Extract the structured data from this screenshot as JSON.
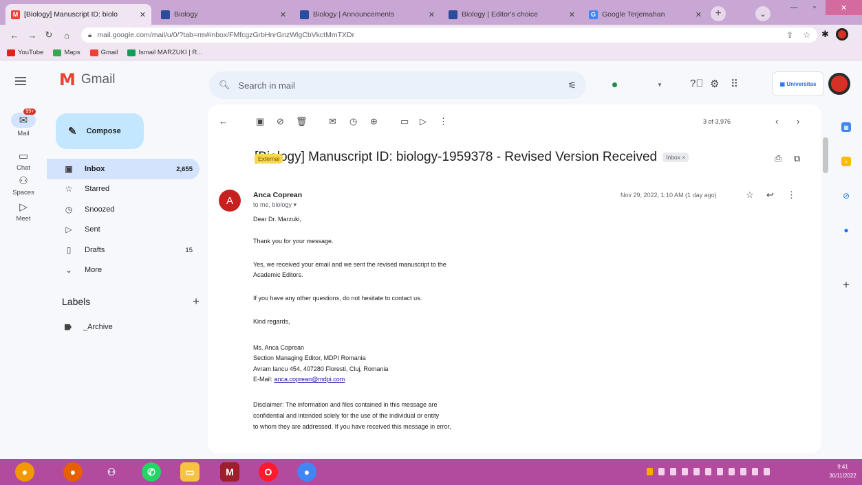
{
  "browser": {
    "tabs": [
      {
        "title": "[Biology] Manuscript ID: biolo",
        "active": true
      },
      {
        "title": "Biology",
        "active": false
      },
      {
        "title": "Biology | Announcements",
        "active": false
      },
      {
        "title": "Biology | Editor's choice",
        "active": false
      },
      {
        "title": "Google Terjemahan",
        "active": false
      }
    ],
    "url": "mail.google.com/mail/u/0/?tab=rm#inbox/FMfcgzGrbHnrGnzWlgCbVkctMmTXDr",
    "bookmarks": [
      "YouTube",
      "Maps",
      "Gmail",
      "Ismail MARZUKI | R..."
    ]
  },
  "gmail": {
    "app_name": "Gmail",
    "search_placeholder": "Search in mail",
    "compose_label": "Compose",
    "rail": [
      {
        "label": "Mail",
        "badge": "99+"
      },
      {
        "label": "Chat"
      },
      {
        "label": "Spaces"
      },
      {
        "label": "Meet"
      }
    ],
    "nav": [
      {
        "label": "Inbox",
        "count": "2,655"
      },
      {
        "label": "Starred",
        "count": ""
      },
      {
        "label": "Snoozed",
        "count": ""
      },
      {
        "label": "Sent",
        "count": ""
      },
      {
        "label": "Drafts",
        "count": "15"
      },
      {
        "label": "More",
        "count": ""
      }
    ],
    "labels_heading": "Labels",
    "labels": [
      "_Archive"
    ],
    "pager": "3 of 3,976"
  },
  "email": {
    "subject": "[Biology] Manuscript ID: biology-1959378 - Revised Version Received",
    "chip_external": "External",
    "chip_inbox": "Inbox ×",
    "sender_initial": "A",
    "sender_name": "Anca Coprean",
    "recipients": "to me, biology ▾",
    "date": "Nov 29, 2022, 1:10 AM (1 day ago)",
    "greeting": "Dear Dr. Marzuki,",
    "p1": "Thank you for your message.",
    "p2_l1": "Yes, we received your email and we sent the revised manuscript to the",
    "p2_l2": "Academic Editors.",
    "p3": "If you have any other questions, do not hesitate to contact us.",
    "closing": "Kind regards,",
    "sig_name": "Ms. Anca Coprean",
    "sig_title": "Section Managing Editor, MDPI Romania",
    "sig_address": "Avram Iancu 454, 407280 Floresti, Cluj, Romania",
    "sig_email_label": "E-Mail:",
    "sig_email": "anca.coprean@mdpi.com",
    "disc_l1": "Disclaimer: The information and files contained in this message are",
    "disc_l2": "confidential and intended solely for the use of the individual or entity",
    "disc_l3": "to whom they are addressed. If you have received this message in error,"
  },
  "taskbar": {
    "time": "9:41",
    "date": "30/11/2022"
  },
  "colors": {
    "tabstrip": "#c9a7d4",
    "taskbar": "#b24a9e",
    "gmail_red": "#ea4335",
    "compose_bg": "#c2e7ff",
    "selected_nav": "#d3e3fd"
  }
}
